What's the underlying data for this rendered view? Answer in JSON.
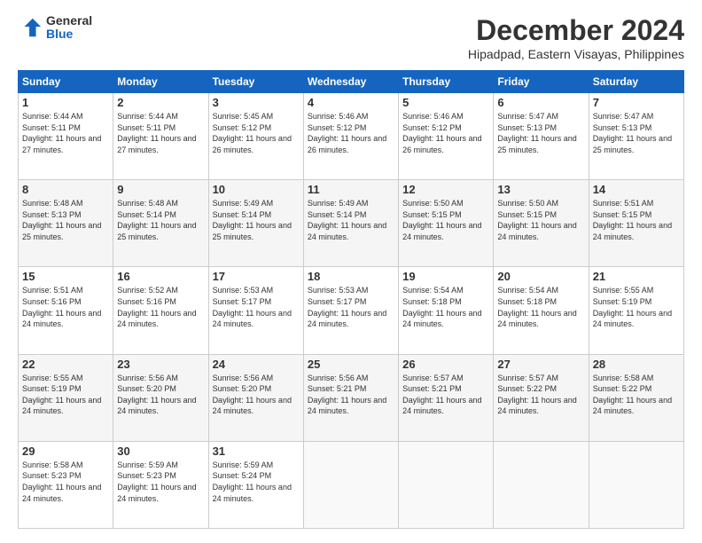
{
  "header": {
    "logo_general": "General",
    "logo_blue": "Blue",
    "month_title": "December 2024",
    "location": "Hipadpad, Eastern Visayas, Philippines"
  },
  "calendar": {
    "days_of_week": [
      "Sunday",
      "Monday",
      "Tuesday",
      "Wednesday",
      "Thursday",
      "Friday",
      "Saturday"
    ],
    "weeks": [
      [
        {
          "day": "1",
          "sunrise": "5:44 AM",
          "sunset": "5:11 PM",
          "daylight": "11 hours and 27 minutes."
        },
        {
          "day": "2",
          "sunrise": "5:44 AM",
          "sunset": "5:11 PM",
          "daylight": "11 hours and 27 minutes."
        },
        {
          "day": "3",
          "sunrise": "5:45 AM",
          "sunset": "5:12 PM",
          "daylight": "11 hours and 26 minutes."
        },
        {
          "day": "4",
          "sunrise": "5:46 AM",
          "sunset": "5:12 PM",
          "daylight": "11 hours and 26 minutes."
        },
        {
          "day": "5",
          "sunrise": "5:46 AM",
          "sunset": "5:12 PM",
          "daylight": "11 hours and 26 minutes."
        },
        {
          "day": "6",
          "sunrise": "5:47 AM",
          "sunset": "5:13 PM",
          "daylight": "11 hours and 25 minutes."
        },
        {
          "day": "7",
          "sunrise": "5:47 AM",
          "sunset": "5:13 PM",
          "daylight": "11 hours and 25 minutes."
        }
      ],
      [
        {
          "day": "8",
          "sunrise": "5:48 AM",
          "sunset": "5:13 PM",
          "daylight": "11 hours and 25 minutes."
        },
        {
          "day": "9",
          "sunrise": "5:48 AM",
          "sunset": "5:14 PM",
          "daylight": "11 hours and 25 minutes."
        },
        {
          "day": "10",
          "sunrise": "5:49 AM",
          "sunset": "5:14 PM",
          "daylight": "11 hours and 25 minutes."
        },
        {
          "day": "11",
          "sunrise": "5:49 AM",
          "sunset": "5:14 PM",
          "daylight": "11 hours and 24 minutes."
        },
        {
          "day": "12",
          "sunrise": "5:50 AM",
          "sunset": "5:15 PM",
          "daylight": "11 hours and 24 minutes."
        },
        {
          "day": "13",
          "sunrise": "5:50 AM",
          "sunset": "5:15 PM",
          "daylight": "11 hours and 24 minutes."
        },
        {
          "day": "14",
          "sunrise": "5:51 AM",
          "sunset": "5:15 PM",
          "daylight": "11 hours and 24 minutes."
        }
      ],
      [
        {
          "day": "15",
          "sunrise": "5:51 AM",
          "sunset": "5:16 PM",
          "daylight": "11 hours and 24 minutes."
        },
        {
          "day": "16",
          "sunrise": "5:52 AM",
          "sunset": "5:16 PM",
          "daylight": "11 hours and 24 minutes."
        },
        {
          "day": "17",
          "sunrise": "5:53 AM",
          "sunset": "5:17 PM",
          "daylight": "11 hours and 24 minutes."
        },
        {
          "day": "18",
          "sunrise": "5:53 AM",
          "sunset": "5:17 PM",
          "daylight": "11 hours and 24 minutes."
        },
        {
          "day": "19",
          "sunrise": "5:54 AM",
          "sunset": "5:18 PM",
          "daylight": "11 hours and 24 minutes."
        },
        {
          "day": "20",
          "sunrise": "5:54 AM",
          "sunset": "5:18 PM",
          "daylight": "11 hours and 24 minutes."
        },
        {
          "day": "21",
          "sunrise": "5:55 AM",
          "sunset": "5:19 PM",
          "daylight": "11 hours and 24 minutes."
        }
      ],
      [
        {
          "day": "22",
          "sunrise": "5:55 AM",
          "sunset": "5:19 PM",
          "daylight": "11 hours and 24 minutes."
        },
        {
          "day": "23",
          "sunrise": "5:56 AM",
          "sunset": "5:20 PM",
          "daylight": "11 hours and 24 minutes."
        },
        {
          "day": "24",
          "sunrise": "5:56 AM",
          "sunset": "5:20 PM",
          "daylight": "11 hours and 24 minutes."
        },
        {
          "day": "25",
          "sunrise": "5:56 AM",
          "sunset": "5:21 PM",
          "daylight": "11 hours and 24 minutes."
        },
        {
          "day": "26",
          "sunrise": "5:57 AM",
          "sunset": "5:21 PM",
          "daylight": "11 hours and 24 minutes."
        },
        {
          "day": "27",
          "sunrise": "5:57 AM",
          "sunset": "5:22 PM",
          "daylight": "11 hours and 24 minutes."
        },
        {
          "day": "28",
          "sunrise": "5:58 AM",
          "sunset": "5:22 PM",
          "daylight": "11 hours and 24 minutes."
        }
      ],
      [
        {
          "day": "29",
          "sunrise": "5:58 AM",
          "sunset": "5:23 PM",
          "daylight": "11 hours and 24 minutes."
        },
        {
          "day": "30",
          "sunrise": "5:59 AM",
          "sunset": "5:23 PM",
          "daylight": "11 hours and 24 minutes."
        },
        {
          "day": "31",
          "sunrise": "5:59 AM",
          "sunset": "5:24 PM",
          "daylight": "11 hours and 24 minutes."
        },
        null,
        null,
        null,
        null
      ]
    ]
  }
}
